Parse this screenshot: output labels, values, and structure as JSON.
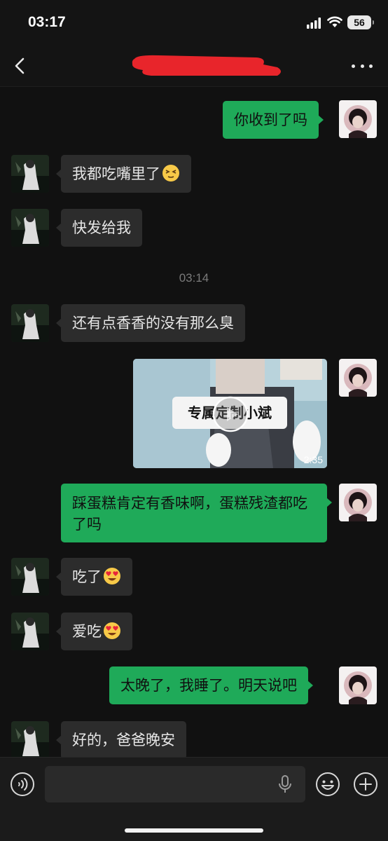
{
  "status_bar": {
    "time": "03:17",
    "battery": "56"
  },
  "nav": {
    "title_redacted": true,
    "icons": [
      "back-icon",
      "more-icon"
    ]
  },
  "chat": {
    "timestamp": "03:14",
    "messages": [
      {
        "from": "me",
        "text": "你收到了吗"
      },
      {
        "from": "them",
        "text": "我都吃嘴里了",
        "emoji": "face-emoji"
      },
      {
        "from": "them",
        "text": "快发给我"
      },
      {
        "from": "them",
        "text": "还有点香香的没有那么臭"
      },
      {
        "from": "me",
        "type": "video",
        "overlay_text": "专属定制小斌",
        "duration": "2:35"
      },
      {
        "from": "me",
        "text": "踩蛋糕肯定有香味啊，蛋糕残渣都吃了吗"
      },
      {
        "from": "them",
        "text": "吃了",
        "emoji": "heart-eyes-emoji"
      },
      {
        "from": "them",
        "text": "爱吃",
        "emoji": "heart-eyes-emoji"
      },
      {
        "from": "me",
        "text": "太晚了，我睡了。明天说吧"
      },
      {
        "from": "them",
        "text": "好的，爸爸晚安"
      }
    ]
  },
  "input_bar": {
    "placeholder": "",
    "icons": [
      "voice-icon",
      "mic-icon",
      "emoji-icon",
      "plus-icon"
    ]
  },
  "colors": {
    "background": "#111111",
    "outgoing_bubble": "#1faa59",
    "incoming_bubble": "#2c2c2c",
    "redaction": "#e8252b"
  }
}
